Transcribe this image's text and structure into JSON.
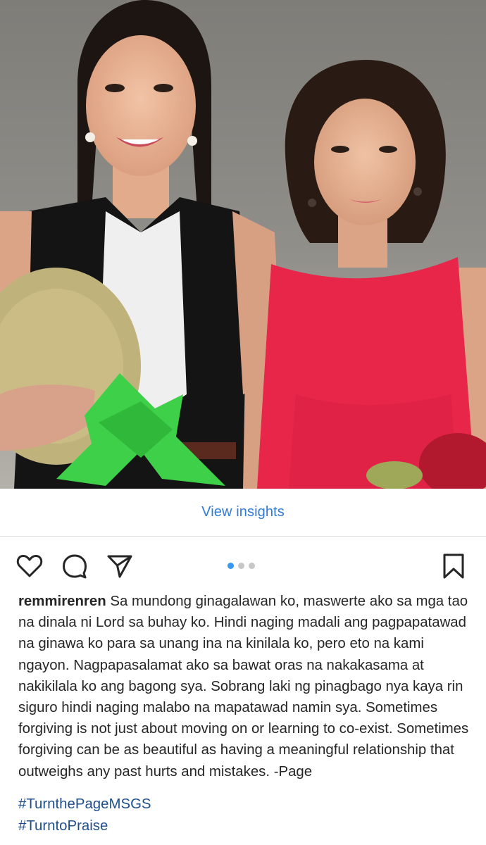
{
  "post": {
    "image": {
      "description_icon": "photo-image"
    },
    "insights": {
      "label": "View insights",
      "color": "#2f7bd6"
    },
    "actions": {
      "like_icon": "heart-icon",
      "comment_icon": "comment-icon",
      "share_icon": "send-icon",
      "save_icon": "bookmark-icon"
    },
    "carousel": {
      "total": 3,
      "active": 1
    },
    "caption": {
      "username": "remmirenren",
      "text": "Sa mundong ginagalawan ko, maswerte ako sa mga tao na dinala ni Lord sa buhay ko. Hindi naging madali ang pagpapatawad na ginawa ko para sa unang ina na kinilala ko, pero eto na kami ngayon. Nagpapasalamat ako sa bawat oras na nakakasama at nakikilala ko ang bagong sya. Sobrang laki ng pinagbago nya kaya rin siguro hindi naging malabo na mapatawad namin sya. Sometimes forgiving is not just about moving on or learning to co-exist. Sometimes forgiving can be as beautiful as having a meaningful relationship that outweighs any past hurts and mistakes. -Page"
    },
    "hashtags": [
      "#TurnthePageMSGS",
      "#TurntoPraise"
    ]
  }
}
